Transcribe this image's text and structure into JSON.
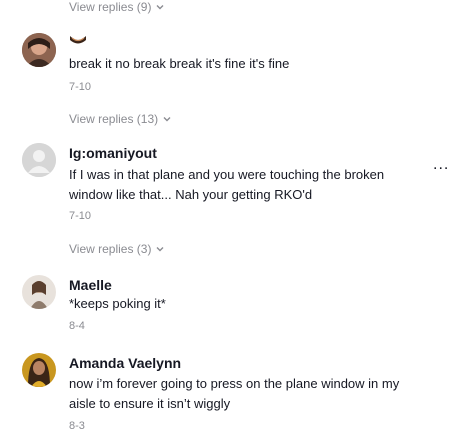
{
  "replies_link_1": {
    "label": "View replies (9)"
  },
  "comment_1": {
    "username_emoji": "",
    "text": "break it no break break it's fine it's fine",
    "date": "7-10"
  },
  "replies_link_2": {
    "label": "View replies (13)"
  },
  "comment_2": {
    "username": "Ig:omaniyout",
    "text": "If I was in that plane and you were touching the broken window like that... Nah your getting RKO'd",
    "date": "7-10",
    "more": "..."
  },
  "replies_link_3": {
    "label": "View replies (3)"
  },
  "comment_3": {
    "username": "Maelle",
    "text": "*keeps poking it*",
    "date": "8-4"
  },
  "comment_4": {
    "username": "Amanda Vaelynn",
    "text": "now i’m forever going to press on the plane window in my aisle to ensure it isn’t wiggly",
    "date": "8-3"
  }
}
